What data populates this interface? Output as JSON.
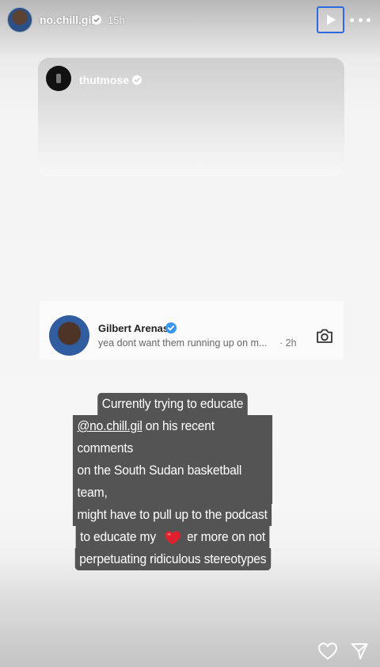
{
  "header": {
    "username": "no.chill.gil",
    "time": "15h"
  },
  "embedded_post": {
    "username": "thutmose"
  },
  "comment": {
    "author": "Gilbert Arenas",
    "text": "yea dont want them running up on m...",
    "time": "· 2h"
  },
  "caption": {
    "line1": "Currently trying to educate",
    "mention": "@no.chill.gil",
    "line2_rest": " on his recent comments",
    "line3": "on the South Sudan basketball team,",
    "line4": "might have to pull up to the podcast",
    "line5": "to educate my brother more on not",
    "line6": "perpetuating ridiculous stereotypes"
  },
  "icons": {
    "verified": "verified-badge-icon",
    "play": "play-icon",
    "more": "more-options-icon",
    "camera": "camera-icon",
    "heart": "red-heart-emoji",
    "like": "heart-outline-icon",
    "share": "paper-plane-icon"
  },
  "colors": {
    "verified_blue": "#3897f0",
    "caption_bg": "#545454",
    "play_border": "#2d6ae0"
  }
}
